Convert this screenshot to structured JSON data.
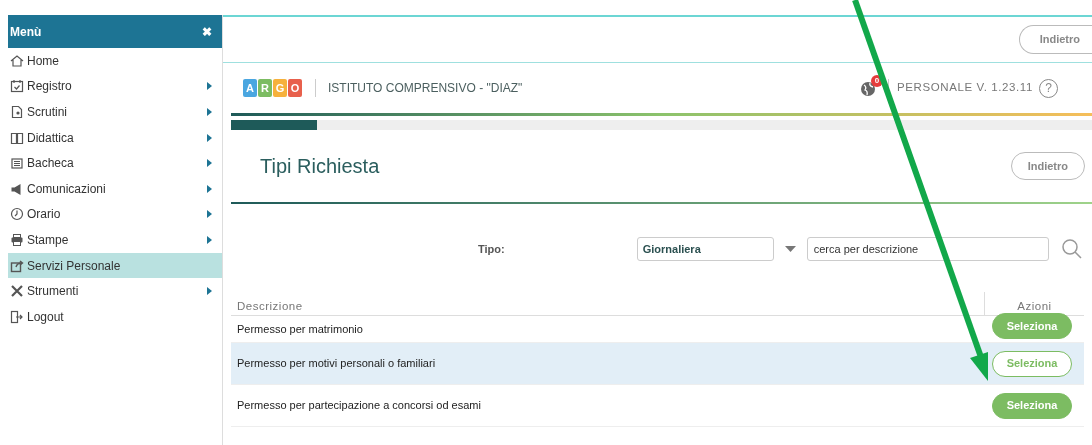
{
  "sidebar": {
    "title": "Menù",
    "close": "✖",
    "items": [
      {
        "label": "Home",
        "submenu": false,
        "selected": false
      },
      {
        "label": "Registro",
        "submenu": true,
        "selected": false
      },
      {
        "label": "Scrutini",
        "submenu": true,
        "selected": false
      },
      {
        "label": "Didattica",
        "submenu": true,
        "selected": false
      },
      {
        "label": "Bacheca",
        "submenu": true,
        "selected": false
      },
      {
        "label": "Comunicazioni",
        "submenu": true,
        "selected": false
      },
      {
        "label": "Orario",
        "submenu": true,
        "selected": false
      },
      {
        "label": "Stampe",
        "submenu": true,
        "selected": false
      },
      {
        "label": "Servizi Personale",
        "submenu": false,
        "selected": true
      },
      {
        "label": "Strumenti",
        "submenu": true,
        "selected": false
      },
      {
        "label": "Logout",
        "submenu": false,
        "selected": false
      }
    ]
  },
  "top_bar": {
    "back_button": "Indietro"
  },
  "header": {
    "logo_letters": [
      "A",
      "R",
      "G",
      "O"
    ],
    "school": "ISTITUTO COMPRENSIVO - \"DIAZ\"",
    "notifications": "0",
    "version": "PERSONALE V. 1.23.11",
    "help": "?"
  },
  "progress": {
    "level": 0.1
  },
  "page": {
    "title": "Tipi Richiesta",
    "back_button": "Indietro"
  },
  "filter": {
    "label": "Tipo:",
    "type_value": "Giornaliera",
    "search": {
      "placeholder": "cerca per descrizione"
    }
  },
  "table": {
    "columns": [
      "Descrizione",
      "Azioni"
    ],
    "rows": [
      {
        "description": "Permesso per matrimonio",
        "action": "Seleziona",
        "selected": false
      },
      {
        "description": "Permesso per motivi personali o familiari",
        "action": "Seleziona",
        "selected": true
      },
      {
        "description": "Permesso per partecipazione a concorsi od esami",
        "action": "Seleziona",
        "selected": false
      }
    ]
  }
}
